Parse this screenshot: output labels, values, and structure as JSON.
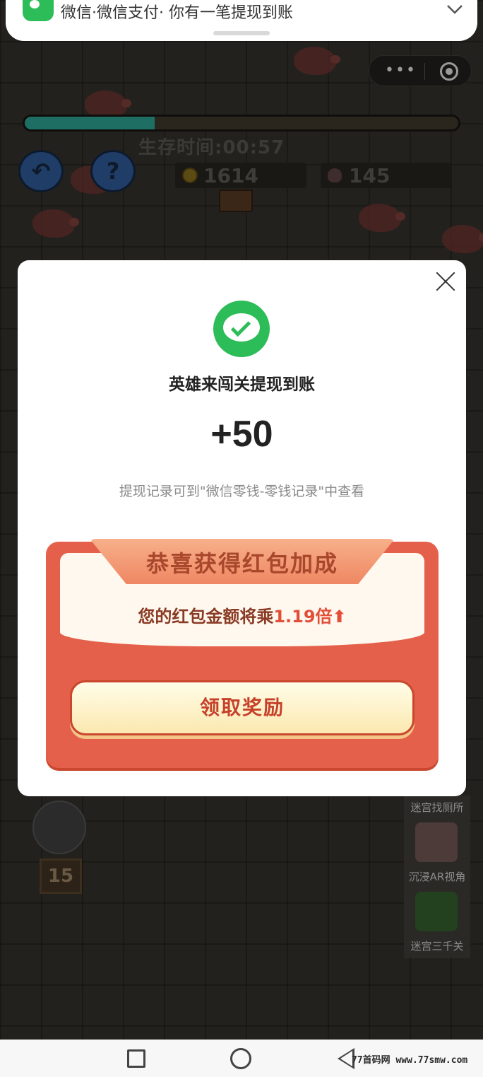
{
  "notification": {
    "text": "微信·微信支付· 你有一笔提现到账"
  },
  "game": {
    "progress_fraction": 0.3,
    "survive_time": "生存时间:00:57",
    "coins": "1614",
    "kills": "145",
    "weapon_count": "15"
  },
  "recommend": {
    "items": [
      {
        "label": "迷宫找厕所"
      },
      {
        "label": "沉浸AR视角"
      },
      {
        "label": "迷宫三千关"
      }
    ]
  },
  "modal": {
    "title": "英雄来闯关提现到账",
    "amount": "+50",
    "hint": "提现记录可到\"微信零钱-零钱记录\"中查看",
    "bonus_title": "恭喜获得红包加成",
    "bonus_desc_prefix": "您的红包金额将乘",
    "bonus_multiplier": "1.19倍",
    "claim_label": "领取奖励"
  },
  "watermark": "77首码网 www.77smw.com",
  "colors": {
    "wechat_green": "#2dbd58",
    "bonus_red": "#e5604a",
    "progress_teal": "#1f6e63"
  }
}
